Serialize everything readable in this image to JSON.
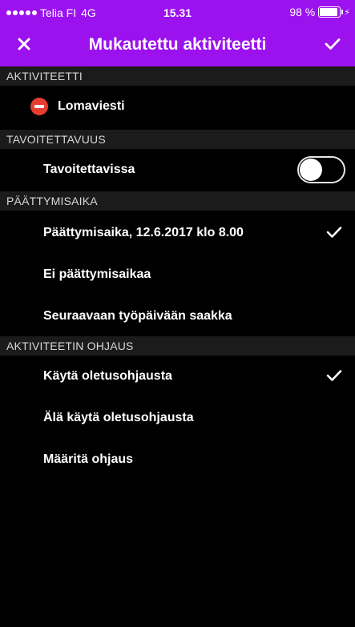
{
  "status_bar": {
    "carrier": "Telia FI",
    "network": "4G",
    "time": "15.31",
    "battery_text": "98 %",
    "battery_level": 0.98
  },
  "navbar": {
    "title": "Mukautettu aktiviteetti",
    "close_icon": "close-icon",
    "done_icon": "checkmark-icon"
  },
  "colors": {
    "accent": "#9b12ee",
    "background": "#000000",
    "section_header": "#1b1b1b",
    "no_entry": "#e83e2f"
  },
  "sections": {
    "activity": {
      "header": "AKTIVITEETTI",
      "item": "Lomaviesti",
      "icon": "no-entry-icon"
    },
    "reachability": {
      "header": "TAVOITETTAVUUS",
      "item": "Tavoitettavissa",
      "toggle_on": false
    },
    "end_time": {
      "header": "PÄÄTTYMISAIKA",
      "options": [
        {
          "label": "Päättymisaika,  12.6.2017 klo 8.00",
          "selected": true
        },
        {
          "label": "Ei päättymisaikaa",
          "selected": false
        },
        {
          "label": "Seuraavaan työpäivään saakka",
          "selected": false
        }
      ]
    },
    "routing": {
      "header": "AKTIVITEETIN OHJAUS",
      "options": [
        {
          "label": "Käytä oletusohjausta",
          "selected": true
        },
        {
          "label": "Älä käytä oletusohjausta",
          "selected": false
        },
        {
          "label": "Määritä ohjaus",
          "selected": false
        }
      ]
    }
  }
}
